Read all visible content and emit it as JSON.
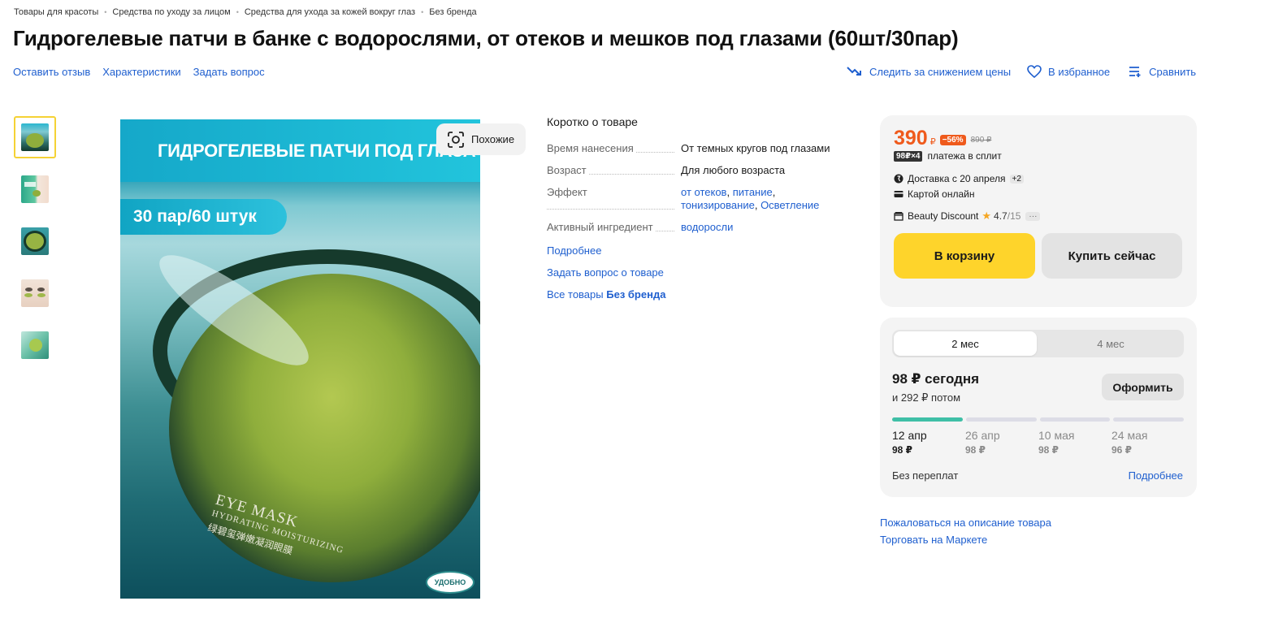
{
  "breadcrumbs": [
    "Товары для красоты",
    "Средства по уходу за лицом",
    "Средства для ухода за кожей вокруг глаз",
    "Без бренда"
  ],
  "title": "Гидрогелевые патчи в банке с водорослями, от отеков и мешков под глазами (60шт/30пар)",
  "actions_left": {
    "review": "Оставить отзыв",
    "specs": "Характеристики",
    "question": "Задать вопрос"
  },
  "actions_right": {
    "track_price": "Следить за снижением цены",
    "favorite": "В избранное",
    "compare": "Сравнить"
  },
  "gallery": {
    "thumb_count": 5,
    "similar_label": "Похожие",
    "image_text": {
      "banner": "ГИДРОГЕЛЕВЫЕ ПАТЧИ ПОД ГЛАЗА",
      "pill": "30 пар/60 штук",
      "jar_1": "EYE MASK",
      "jar_2": "HYDRATING MOISTURIZING",
      "jar_3": "绿碧玺弹嫩凝润眼膜",
      "badge": "УДОБНО"
    }
  },
  "short_info": {
    "heading": "Коротко о товаре",
    "specs": [
      {
        "key": "Время нанесения",
        "value": "От темных кругов под глазами"
      },
      {
        "key": "Возраст",
        "value": "Для любого возраста"
      },
      {
        "key": "Эффект",
        "links": [
          "от отеков",
          "питание",
          "тонизирование",
          "Осветление"
        ]
      },
      {
        "key": "Активный ингредиент",
        "links": [
          "водоросли"
        ]
      }
    ],
    "more": "Подробнее",
    "ask": "Задать вопрос о товаре",
    "all_prefix": "Все товары",
    "all_brand": "Без бренда"
  },
  "buy": {
    "price": "390",
    "currency": "₽",
    "discount": "−56%",
    "old_price": "890 ₽",
    "split_tag": "98₽×4",
    "split_text": "платежа в сплит",
    "delivery": "Доставка с 20 апреля",
    "delivery_more": "+2",
    "payment": "Картой онлайн",
    "shop": "Beauty Discount",
    "rating": "4.7",
    "rating_total": "/15",
    "more_dots": "···",
    "cart_btn": "В корзину",
    "buy_now_btn": "Купить сейчас"
  },
  "split_plan": {
    "tabs": [
      "2 мес",
      "4 мес"
    ],
    "active_tab": 0,
    "today": "98 ₽ сегодня",
    "later": "и 292 ₽ потом",
    "apply_btn": "Оформить",
    "progress_done": 1,
    "payments": [
      {
        "date": "12 апр",
        "amount": "98 ₽"
      },
      {
        "date": "26 апр",
        "amount": "98 ₽"
      },
      {
        "date": "10 мая",
        "amount": "98 ₽"
      },
      {
        "date": "24 мая",
        "amount": "96 ₽"
      }
    ],
    "no_overpay": "Без переплат",
    "more": "Подробнее"
  },
  "bottom_links": {
    "report": "Пожаловаться на описание товара",
    "sell": "Торговать на Маркете"
  },
  "colors": {
    "accent_link": "#1f5fcf",
    "price": "#ef5a1c",
    "cart_button": "#fed42b",
    "progress": "#3fbfa6"
  }
}
